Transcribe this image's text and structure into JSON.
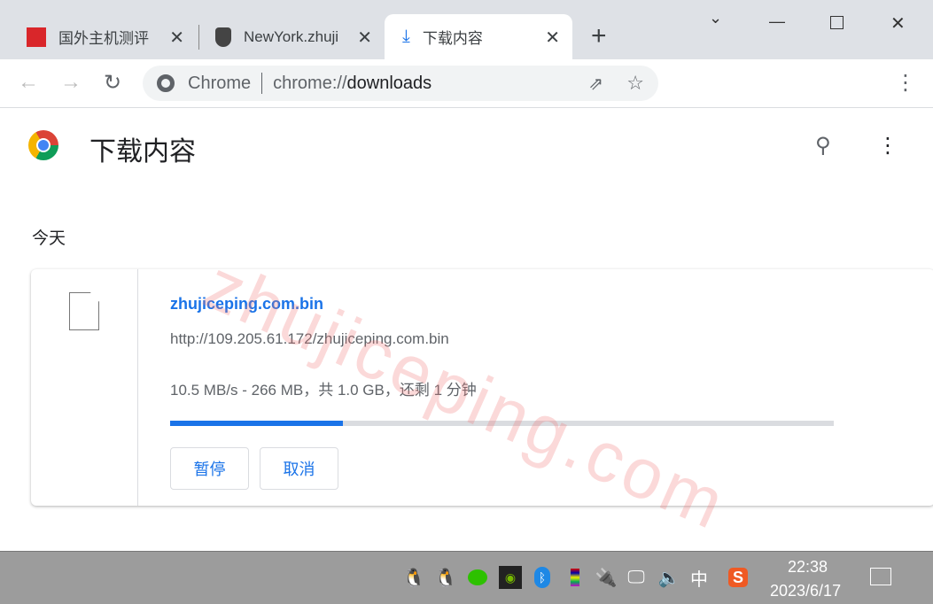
{
  "tabs": [
    {
      "title": "国外主机测评",
      "icon": "site-favicon"
    },
    {
      "title": "NewYork.zhuji",
      "icon": "server-favicon"
    },
    {
      "title": "下载内容",
      "icon": "download-icon",
      "active": true
    }
  ],
  "new_tab": "+",
  "omnibox": {
    "label": "Chrome",
    "url_prefix": "chrome://",
    "url_main": "downloads"
  },
  "page": {
    "title": "下载内容",
    "section": "今天"
  },
  "download": {
    "filename": "zhujiceping.com.bin",
    "url": "http://109.205.61.172/zhujiceping.com.bin",
    "status": "10.5 MB/s - 266 MB，共 1.0 GB，还剩 1 分钟",
    "progress_percent": 26,
    "pause_label": "暂停",
    "cancel_label": "取消"
  },
  "watermark": "zhujiceping.com",
  "taskbar": {
    "time": "22:38",
    "date": "2023/6/17",
    "ime": "中"
  },
  "colors": {
    "accent": "#1a73e8",
    "progress_track": "#dadce0",
    "taskbar": "#9c9c9c"
  }
}
